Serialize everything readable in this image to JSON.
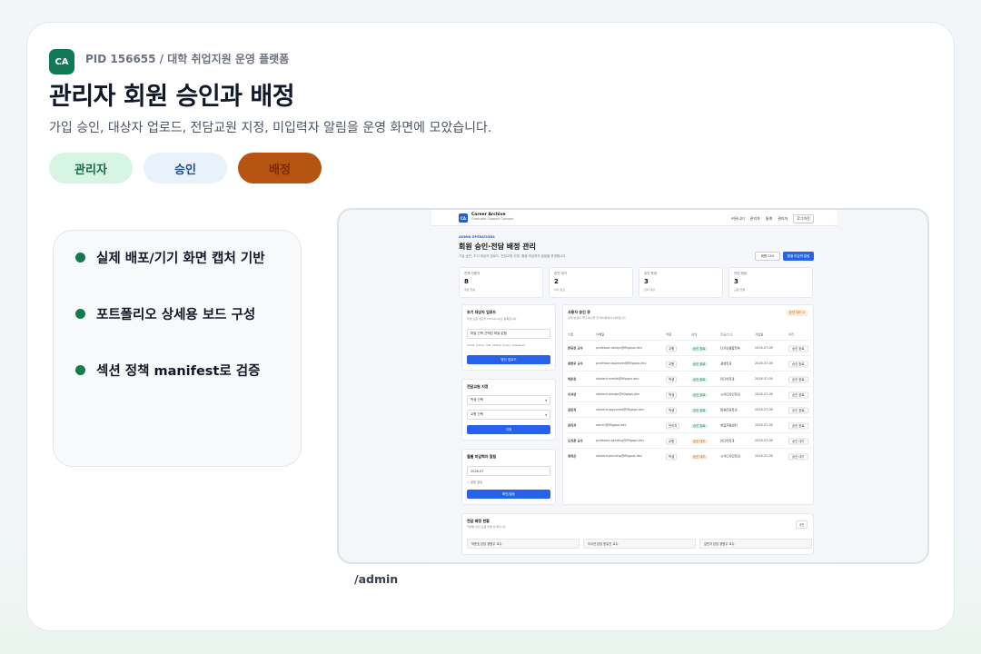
{
  "header": {
    "logo_text": "CA",
    "pid": "PID 156655 / 대학 취업지원 운영 플랫폼",
    "title": "관리자 회원 승인과 배정",
    "subtitle": "가입 승인, 대상자 업로드, 전담교원 지정, 미입력자 알림을 운영 화면에 모았습니다.",
    "chips": [
      "관리자",
      "승인",
      "배정"
    ]
  },
  "features": [
    "실제 배포/기기 화면 캡처 기반",
    "포트폴리오 상세용 보드 구성",
    "섹션 정책 manifest로 검증"
  ],
  "screenshot_path": "/admin",
  "app": {
    "brand": "Career Archive",
    "brand_sub": "Graduate Support Console",
    "logo_text": "CA",
    "nav": [
      "커뮤니티",
      "관리자",
      "통계",
      "관리자",
      "로그아웃"
    ],
    "eyebrow": "ADMIN OPERATIONS",
    "title": "회원 승인·전담 배정 관리",
    "desc": "가입 승인, 초기 대상자 업로드, 전담교원 지정, 월별 미입력자 알림을 운영합니다.",
    "btn_csv": "회원 CSV",
    "btn_notify": "월별 미입력 알림",
    "stats": [
      {
        "label": "전체 사용자",
        "value": "8",
        "note": "계정 현황"
      },
      {
        "label": "승인 대기",
        "value": "2",
        "note": "처리 필요"
      },
      {
        "label": "승인 학생",
        "value": "3",
        "note": "관리 대상"
      },
      {
        "label": "전담 배정",
        "value": "3",
        "note": "교원 연결"
      }
    ],
    "upload": {
      "title": "초기 대상자 업로드",
      "sub": "학생 교원 명단을 CSV/XLSX로 등록합니다.",
      "file": "파일 선택  선택된 파일 없음",
      "hint": "email, name, role, status, major, password",
      "button": "명단 업로드"
    },
    "assign": {
      "title": "전담교원 지정",
      "student": "학생 선택",
      "teacher": "교원 선택",
      "button": "지정"
    },
    "monthly": {
      "title": "월별 미입력자 알림",
      "month": "2026-07",
      "check": "알림 발송",
      "button": "확인/발송"
    },
    "approval": {
      "title": "사용자 승인 큐",
      "sub": "상태 변경과 역할 확인을 한 테이블에서 처리합니다.",
      "badge": "승인 대기 2",
      "headers": [
        "이름",
        "이메일",
        "역할",
        "상태",
        "전공/소속",
        "가입일",
        "처리"
      ],
      "rows": [
        {
          "name": "한유진 교수",
          "email": "professor.design@fillgaps.dev",
          "role": "교원",
          "status": "승인 완료",
          "status_type": "ok",
          "dept": "디자인융합학부",
          "date": "2026-07-08",
          "action": "승인 완료"
        },
        {
          "name": "정현우 교수",
          "email": "professor.approved@fillgaps.dev",
          "role": "교원",
          "status": "승인 완료",
          "status_type": "ok",
          "dept": "경영학과",
          "date": "2026-07-08",
          "action": "승인 완료"
        },
        {
          "name": "박준호",
          "email": "student.media@fillgaps.dev",
          "role": "학생",
          "status": "승인 완료",
          "status_type": "ok",
          "dept": "미디어학과",
          "date": "2026-07-08",
          "action": "승인 완료"
        },
        {
          "name": "이서연",
          "email": "student.design@fillgaps.dev",
          "role": "학생",
          "status": "승인 완료",
          "status_type": "ok",
          "dept": "시각디자인학과",
          "date": "2026-07-08",
          "action": "승인 완료"
        },
        {
          "name": "김민지",
          "email": "student.approved@fillgaps.dev",
          "role": "학생",
          "status": "승인 완료",
          "status_type": "ok",
          "dept": "컴퓨터공학과",
          "date": "2026-07-08",
          "action": "승인 완료"
        },
        {
          "name": "관리자",
          "email": "admin@fillgaps.dev",
          "role": "관리자",
          "status": "승인 완료",
          "status_type": "ok",
          "dept": "취업지원센터",
          "date": "2026-07-08",
          "action": "승인 완료"
        },
        {
          "name": "오지훈 교수",
          "email": "professor.pending@fillgaps.dev",
          "role": "교원",
          "status": "승인 대기",
          "status_type": "wait",
          "dept": "미디어학과",
          "date": "2026-07-08",
          "action": "승인 대기"
        },
        {
          "name": "최하은",
          "email": "student.pending@fillgaps.dev",
          "role": "학생",
          "status": "승인 대기",
          "status_type": "wait",
          "dept": "시각디자인학과",
          "date": "2026-07-08",
          "action": "승인 대기"
        }
      ]
    },
    "assignments": {
      "title": "전담 배정 현황",
      "sub": "학생별 담당 교원 연결 상태입니다.",
      "count": "3건",
      "items": [
        "박준호 담당 정현우 교수",
        "이서연 담당 한유진 교수",
        "김민지 담당 정현우 교수"
      ]
    }
  }
}
